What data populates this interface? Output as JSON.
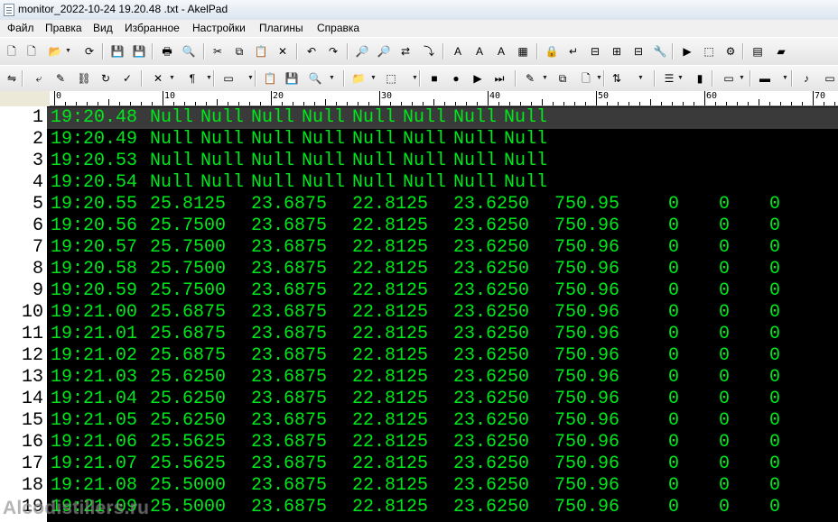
{
  "window": {
    "title": "monitor_2022-10-24 19.20.48 .txt - AkelPad"
  },
  "menu": [
    "Файл",
    "Правка",
    "Вид",
    "Избранное",
    "Настройки",
    "Плагины",
    "Справка"
  ],
  "ruler": {
    "labels": [
      "0",
      "10",
      "20",
      "30",
      "40",
      "50",
      "60",
      "70"
    ]
  },
  "editor": {
    "line_numbers": [
      "1",
      "2",
      "3",
      "4",
      "5",
      "6",
      "7",
      "8",
      "9",
      "10",
      "11",
      "12",
      "13",
      "14",
      "15",
      "16",
      "17",
      "18",
      "19"
    ],
    "rows": [
      [
        "19:20.48",
        "Null",
        "Null",
        "Null",
        "Null",
        "Null",
        "Null",
        "Null",
        "Null"
      ],
      [
        "19:20.49",
        "Null",
        "Null",
        "Null",
        "Null",
        "Null",
        "Null",
        "Null",
        "Null"
      ],
      [
        "19:20.53",
        "Null",
        "Null",
        "Null",
        "Null",
        "Null",
        "Null",
        "Null",
        "Null"
      ],
      [
        "19:20.54",
        "Null",
        "Null",
        "Null",
        "Null",
        "Null",
        "Null",
        "Null",
        "Null"
      ],
      [
        "19:20.55",
        "25.8125",
        "23.6875",
        "22.8125",
        "23.6250",
        "750.95",
        "0",
        "0",
        "0"
      ],
      [
        "19:20.56",
        "25.7500",
        "23.6875",
        "22.8125",
        "23.6250",
        "750.96",
        "0",
        "0",
        "0"
      ],
      [
        "19:20.57",
        "25.7500",
        "23.6875",
        "22.8125",
        "23.6250",
        "750.96",
        "0",
        "0",
        "0"
      ],
      [
        "19:20.58",
        "25.7500",
        "23.6875",
        "22.8125",
        "23.6250",
        "750.96",
        "0",
        "0",
        "0"
      ],
      [
        "19:20.59",
        "25.7500",
        "23.6875",
        "22.8125",
        "23.6250",
        "750.96",
        "0",
        "0",
        "0"
      ],
      [
        "19:21.00",
        "25.6875",
        "23.6875",
        "22.8125",
        "23.6250",
        "750.96",
        "0",
        "0",
        "0"
      ],
      [
        "19:21.01",
        "25.6875",
        "23.6875",
        "22.8125",
        "23.6250",
        "750.96",
        "0",
        "0",
        "0"
      ],
      [
        "19:21.02",
        "25.6875",
        "23.6875",
        "22.8125",
        "23.6250",
        "750.96",
        "0",
        "0",
        "0"
      ],
      [
        "19:21.03",
        "25.6250",
        "23.6875",
        "22.8125",
        "23.6250",
        "750.96",
        "0",
        "0",
        "0"
      ],
      [
        "19:21.04",
        "25.6250",
        "23.6875",
        "22.8125",
        "23.6250",
        "750.96",
        "0",
        "0",
        "0"
      ],
      [
        "19:21.05",
        "25.6250",
        "23.6875",
        "22.8125",
        "23.6250",
        "750.96",
        "0",
        "0",
        "0"
      ],
      [
        "19:21.06",
        "25.5625",
        "23.6875",
        "22.8125",
        "23.6250",
        "750.96",
        "0",
        "0",
        "0"
      ],
      [
        "19:21.07",
        "25.5625",
        "23.6875",
        "22.8125",
        "23.6250",
        "750.96",
        "0",
        "0",
        "0"
      ],
      [
        "19:21.08",
        "25.5000",
        "23.6875",
        "22.8125",
        "23.6250",
        "750.96",
        "0",
        "0",
        "0"
      ],
      [
        "19:21.09",
        "25.5000",
        "23.6875",
        "22.8125",
        "23.6250",
        "750.96",
        "0",
        "0",
        "0"
      ]
    ],
    "text_color": "#00e81c",
    "background": "#000000"
  },
  "watermark": "Alcodistillers.ru",
  "toolbar1": [
    {
      "name": "new-file-icon",
      "glyph": "🗋"
    },
    {
      "name": "new-window-icon",
      "glyph": "🗋"
    },
    {
      "name": "open-icon",
      "glyph": "📂"
    },
    {
      "name": "open-dropdown-icon",
      "glyph": "▾"
    },
    {
      "name": "reopen-icon",
      "glyph": "⟳"
    },
    {
      "name": "save-icon",
      "glyph": "💾"
    },
    {
      "name": "save-all-icon",
      "glyph": "💾"
    },
    {
      "name": "print-icon",
      "glyph": "🖶"
    },
    {
      "name": "print-preview-icon",
      "glyph": "🔍"
    },
    {
      "name": "cut-icon",
      "glyph": "✂"
    },
    {
      "name": "copy-icon",
      "glyph": "⧉"
    },
    {
      "name": "paste-icon",
      "glyph": "📋"
    },
    {
      "name": "delete-icon",
      "glyph": "✕"
    },
    {
      "name": "undo-icon",
      "glyph": "↶"
    },
    {
      "name": "redo-icon",
      "glyph": "↷"
    },
    {
      "name": "find-icon",
      "glyph": "🔎"
    },
    {
      "name": "find-next-icon",
      "glyph": "🔎"
    },
    {
      "name": "replace-icon",
      "glyph": "⇄"
    },
    {
      "name": "goto-icon",
      "glyph": "⤵"
    },
    {
      "name": "font-icon",
      "glyph": "A"
    },
    {
      "name": "font-bigger-icon",
      "glyph": "A"
    },
    {
      "name": "font-smaller-icon",
      "glyph": "A"
    },
    {
      "name": "color-icon",
      "glyph": "▦"
    },
    {
      "name": "lock-icon",
      "glyph": "🔒"
    },
    {
      "name": "word-wrap-icon",
      "glyph": "↵"
    },
    {
      "name": "split-icon",
      "glyph": "⊟"
    },
    {
      "name": "split-vertical-icon",
      "glyph": "⊞"
    },
    {
      "name": "split-horizontal-icon",
      "glyph": "⊟"
    },
    {
      "name": "tools-icon",
      "glyph": "🔧"
    },
    {
      "name": "run-icon",
      "glyph": "▶"
    },
    {
      "name": "macro-icon",
      "glyph": "⬚"
    },
    {
      "name": "settings-icon",
      "glyph": "⚙"
    },
    {
      "name": "notes-icon",
      "glyph": "▤"
    },
    {
      "name": "highlight-icon",
      "glyph": "▰"
    }
  ],
  "toolbar2": [
    {
      "name": "coder-icon",
      "glyph": "⇋"
    },
    {
      "name": "format-icon",
      "glyph": "⤶"
    },
    {
      "name": "marker-icon",
      "glyph": "✎"
    },
    {
      "name": "link-icon",
      "glyph": "⛓"
    },
    {
      "name": "refresh-icon",
      "glyph": "↻"
    },
    {
      "name": "spell-icon",
      "glyph": "✓"
    },
    {
      "name": "close-all-icon",
      "glyph": "✕"
    },
    {
      "name": "pilcrow-icon",
      "glyph": "¶"
    },
    {
      "name": "view-mode-icon",
      "glyph": "▭"
    },
    {
      "name": "clipboard-icon",
      "glyph": "📋"
    },
    {
      "name": "save-as-icon",
      "glyph": "💾"
    },
    {
      "name": "search-icon",
      "glyph": "🔍"
    },
    {
      "name": "folder-icon",
      "glyph": "📁"
    },
    {
      "name": "tag-icon",
      "glyph": "⬚"
    },
    {
      "name": "stop-icon",
      "glyph": "■"
    },
    {
      "name": "record-icon",
      "glyph": "●"
    },
    {
      "name": "play-icon",
      "glyph": "▶"
    },
    {
      "name": "play-multiple-icon",
      "glyph": "⏭"
    },
    {
      "name": "script-icon",
      "glyph": "✎"
    },
    {
      "name": "duplicate-icon",
      "glyph": "⧉"
    },
    {
      "name": "page-icon",
      "glyph": "🗋"
    },
    {
      "name": "sort-icon",
      "glyph": "⇅"
    },
    {
      "name": "outline-icon",
      "glyph": "☰"
    },
    {
      "name": "bookmark-icon",
      "glyph": "▮"
    },
    {
      "name": "code-icon",
      "glyph": "▭"
    },
    {
      "name": "panel-icon",
      "glyph": "▬"
    },
    {
      "name": "music-icon",
      "glyph": "♪"
    },
    {
      "name": "misc-icon",
      "glyph": "▭"
    }
  ]
}
